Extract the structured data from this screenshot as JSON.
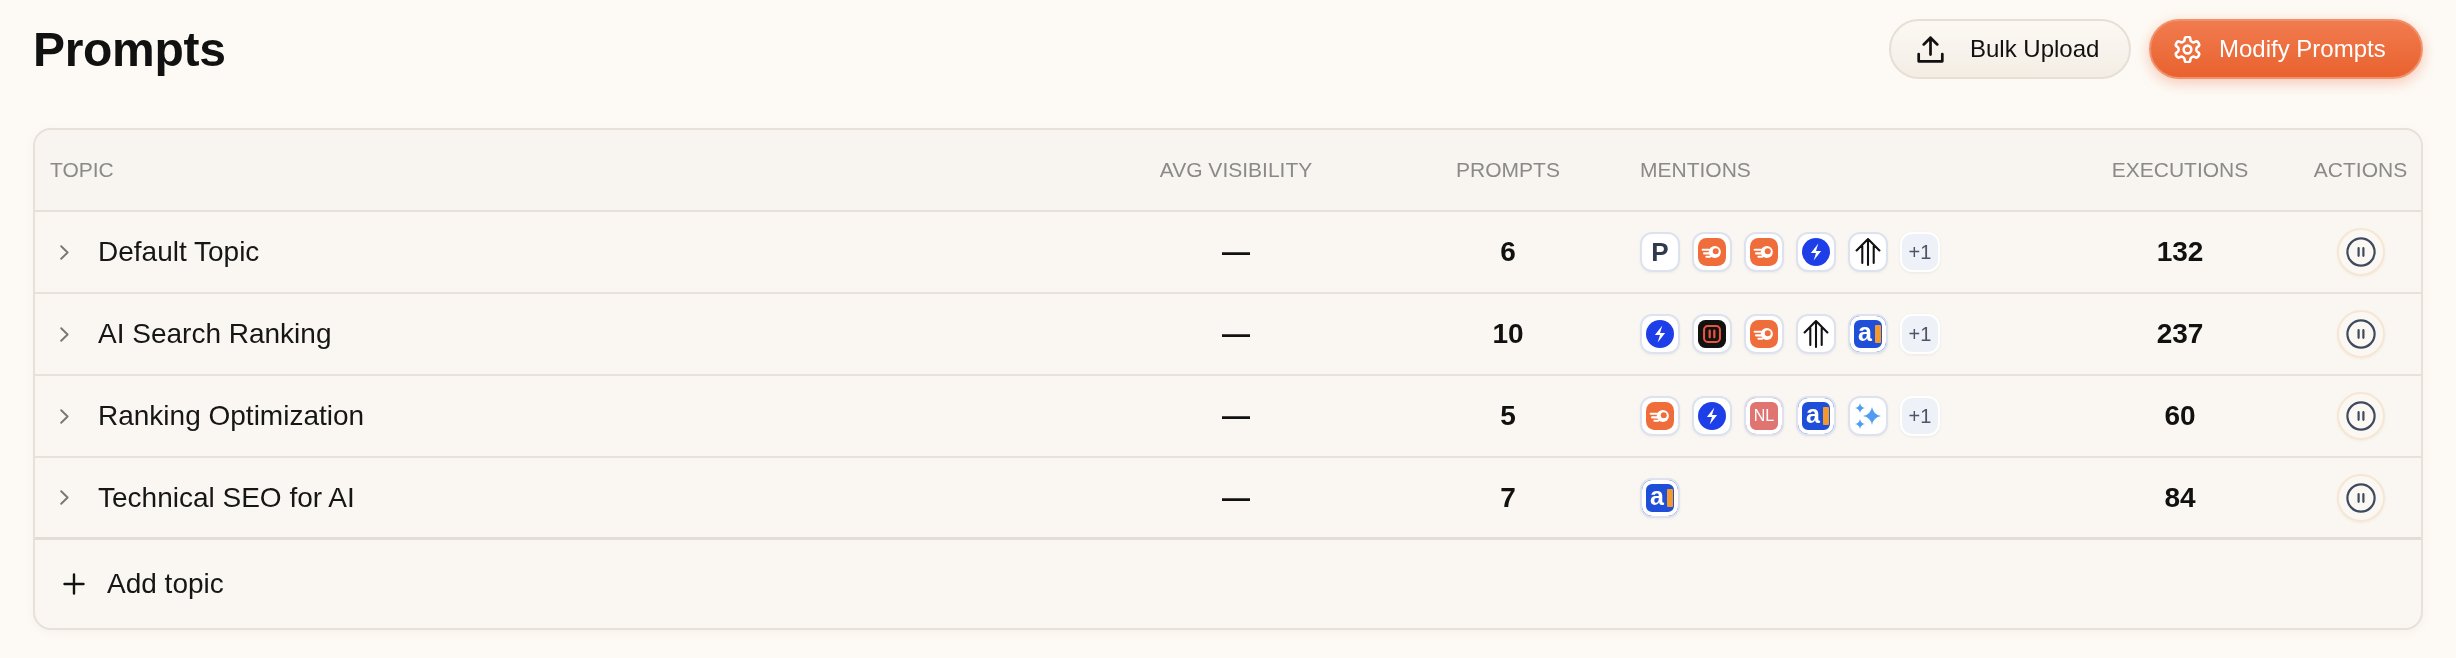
{
  "page": {
    "title": "Prompts"
  },
  "buttons": [
    {
      "kind": "secondary",
      "label": "Bulk Upload"
    },
    {
      "kind": "primary",
      "label": "Modify Prompts"
    }
  ],
  "table": {
    "columns": [
      "TOPIC",
      "AVG VISIBILITY",
      "PROMPTS",
      "MENTIONS",
      "EXECUTIONS",
      "ACTIONS"
    ],
    "rows": [
      {
        "topic": "Default Topic",
        "expanded": false,
        "avg_visibility": "—",
        "prompts": "6",
        "mentions": [
          {
            "kind": "letter",
            "text": "P"
          },
          {
            "kind": "comet"
          },
          {
            "kind": "comet"
          },
          {
            "kind": "bolt"
          },
          {
            "kind": "tree"
          }
        ],
        "more": "+1",
        "executions": "132"
      },
      {
        "topic": "AI Search Ranking",
        "expanded": false,
        "avg_visibility": "—",
        "prompts": "10",
        "mentions": [
          {
            "kind": "bolt"
          },
          {
            "kind": "square"
          },
          {
            "kind": "comet"
          },
          {
            "kind": "tree"
          },
          {
            "kind": "letter-mark",
            "text": "a"
          }
        ],
        "more": "+1",
        "executions": "237"
      },
      {
        "topic": "Ranking Optimization",
        "expanded": false,
        "avg_visibility": "—",
        "prompts": "5",
        "mentions": [
          {
            "kind": "comet"
          },
          {
            "kind": "bolt"
          },
          {
            "kind": "letter-filled",
            "text": "NL",
            "color": "#e07470"
          },
          {
            "kind": "letter-mark",
            "text": "a"
          },
          {
            "kind": "sparkle"
          }
        ],
        "more": "+1",
        "executions": "60"
      },
      {
        "topic": "Technical SEO for AI",
        "expanded": false,
        "avg_visibility": "—",
        "prompts": "7",
        "mentions": [
          {
            "kind": "letter-mark",
            "text": "a"
          }
        ],
        "executions": "84"
      }
    ],
    "add_row": {
      "label": "Add topic"
    }
  }
}
